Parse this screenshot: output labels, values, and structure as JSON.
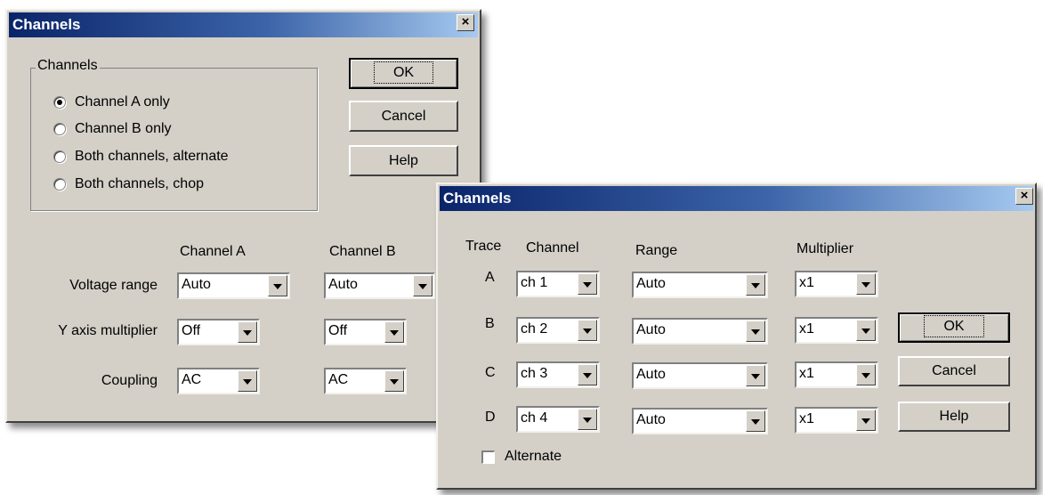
{
  "dialog1": {
    "title": "Channels",
    "close_label": "×",
    "group_label": "Channels",
    "radios": [
      {
        "label": "Channel A only",
        "checked": true
      },
      {
        "label": "Channel B only",
        "checked": false
      },
      {
        "label": "Both channels, alternate",
        "checked": false
      },
      {
        "label": "Both channels, chop",
        "checked": false
      }
    ],
    "ok_label": "OK",
    "cancel_label": "Cancel",
    "help_label": "Help",
    "col_a_header": "Channel A",
    "col_b_header": "Channel B",
    "rows": [
      {
        "label": "Voltage range",
        "a": "Auto",
        "b": "Auto"
      },
      {
        "label": "Y axis multiplier",
        "a": "Off",
        "b": "Off"
      },
      {
        "label": "Coupling",
        "a": "AC",
        "b": "AC"
      }
    ]
  },
  "dialog2": {
    "title": "Channels",
    "close_label": "×",
    "headers": {
      "trace": "Trace",
      "channel": "Channel",
      "range": "Range",
      "multiplier": "Multiplier"
    },
    "rows": [
      {
        "trace": "A",
        "channel": "ch 1",
        "range": "Auto",
        "multiplier": "x1"
      },
      {
        "trace": "B",
        "channel": "ch 2",
        "range": "Auto",
        "multiplier": "x1"
      },
      {
        "trace": "C",
        "channel": "ch 3",
        "range": "Auto",
        "multiplier": "x1"
      },
      {
        "trace": "D",
        "channel": "ch 4",
        "range": "Auto",
        "multiplier": "x1"
      }
    ],
    "ok_label": "OK",
    "cancel_label": "Cancel",
    "help_label": "Help",
    "alternate_label": "Alternate",
    "alternate_checked": false
  },
  "colors": {
    "title_start": "#0a246a",
    "title_end": "#a6caf0",
    "face": "#d4d0c8"
  }
}
